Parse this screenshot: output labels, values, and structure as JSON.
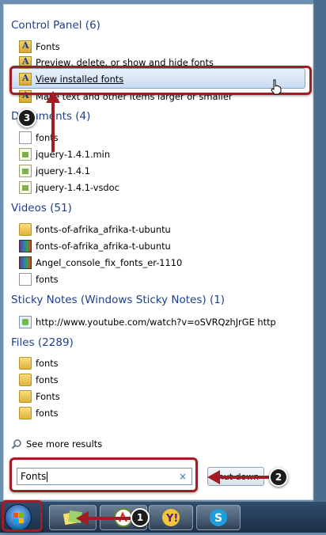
{
  "sections": [
    {
      "key": "control_panel",
      "header": "Control Panel (6)",
      "items": [
        {
          "label": "Fonts",
          "icon": "fonts-folder-icon"
        },
        {
          "label": "Preview, delete, or show and hide fonts",
          "icon": "fonts-folder-icon"
        },
        {
          "label": "View installed fonts",
          "icon": "fonts-folder-icon"
        },
        {
          "label": "Make text and other items larger or smaller",
          "icon": "fonts-folder-icon"
        }
      ]
    },
    {
      "key": "documents",
      "header": "Documents (4)",
      "items": [
        {
          "label": "fonts",
          "icon": "document-icon"
        },
        {
          "label": "jquery-1.4.1.min",
          "icon": "js-file-icon"
        },
        {
          "label": "jquery-1.4.1",
          "icon": "js-file-icon"
        },
        {
          "label": "jquery-1.4.1-vsdoc",
          "icon": "js-file-icon"
        }
      ]
    },
    {
      "key": "videos",
      "header": "Videos (51)",
      "items": [
        {
          "label": "fonts-of-afrika_afrika-t-ubuntu",
          "icon": "folder-icon"
        },
        {
          "label": "fonts-of-afrika_afrika-t-ubuntu",
          "icon": "rar-archive-icon"
        },
        {
          "label": "Angel_console_fix_fonts_er-1110",
          "icon": "rar-archive-icon"
        },
        {
          "label": "fonts",
          "icon": "document-icon"
        }
      ]
    },
    {
      "key": "sticky_notes",
      "header": "Sticky Notes (Windows Sticky Notes) (1)",
      "items": [
        {
          "label": "http://www.youtube.com/watch?v=oSVRQzhJrGE http",
          "icon": "sticky-note-icon"
        }
      ]
    },
    {
      "key": "files",
      "header": "Files (2289)",
      "items": [
        {
          "label": "fonts",
          "icon": "folder-icon"
        },
        {
          "label": "fonts",
          "icon": "folder-icon"
        },
        {
          "label": "Fonts",
          "icon": "folder-icon"
        },
        {
          "label": "fonts",
          "icon": "folder-icon"
        }
      ]
    }
  ],
  "see_more": "See more results",
  "search": {
    "value": "Fonts",
    "clear": "×"
  },
  "shutdown_label": "Shut down",
  "badges": [
    "1",
    "2",
    "3"
  ],
  "colors": {
    "section_header": "#1e3f8c",
    "callout_red": "#a11c24",
    "highlight_bg": "#c9dcf4"
  }
}
